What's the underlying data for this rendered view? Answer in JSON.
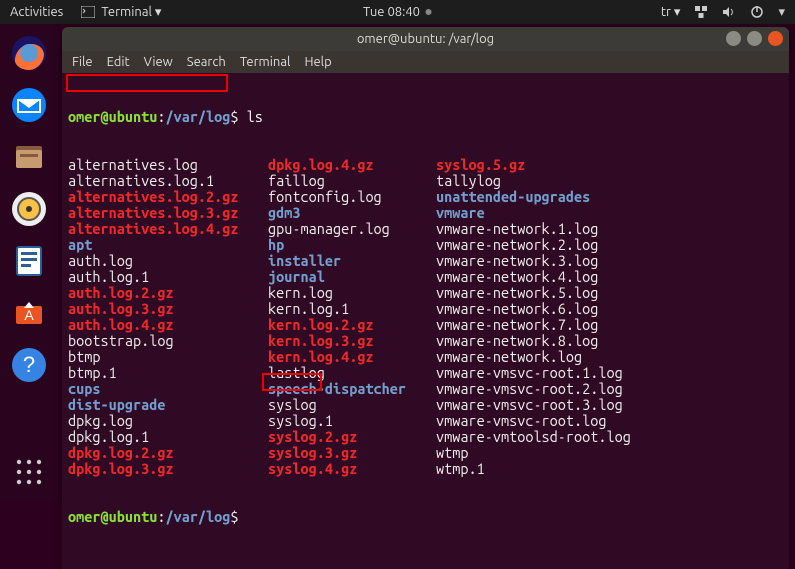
{
  "top_panel": {
    "activities": "Activities",
    "app_indicator": "Terminal ▾",
    "clock": "Tue 08:40",
    "lang": "tr ▾"
  },
  "dock": {
    "items": [
      "firefox",
      "thunderbird",
      "files",
      "rhythmbox",
      "libreoffice",
      "software",
      "help",
      "apps"
    ]
  },
  "window": {
    "title": "omer@ubuntu: /var/log"
  },
  "menubar": {
    "items": [
      "File",
      "Edit",
      "View",
      "Search",
      "Terminal",
      "Help"
    ]
  },
  "prompt": {
    "user_host": "omer@ubuntu",
    "sep": ":",
    "path": "/var/log",
    "dollar": "$",
    "command": "ls"
  },
  "listing": [
    {
      "c1": {
        "t": "alternatives.log",
        "k": "plain"
      },
      "c2": {
        "t": "dpkg.log.4.gz",
        "k": "arch"
      },
      "c3": {
        "t": "syslog.5.gz",
        "k": "arch"
      }
    },
    {
      "c1": {
        "t": "alternatives.log.1",
        "k": "plain"
      },
      "c2": {
        "t": "faillog",
        "k": "plain"
      },
      "c3": {
        "t": "tallylog",
        "k": "plain"
      }
    },
    {
      "c1": {
        "t": "alternatives.log.2.gz",
        "k": "arch"
      },
      "c2": {
        "t": "fontconfig.log",
        "k": "plain"
      },
      "c3": {
        "t": "unattended-upgrades",
        "k": "dir"
      }
    },
    {
      "c1": {
        "t": "alternatives.log.3.gz",
        "k": "arch"
      },
      "c2": {
        "t": "gdm3",
        "k": "dir"
      },
      "c3": {
        "t": "vmware",
        "k": "dir"
      }
    },
    {
      "c1": {
        "t": "alternatives.log.4.gz",
        "k": "arch"
      },
      "c2": {
        "t": "gpu-manager.log",
        "k": "plain"
      },
      "c3": {
        "t": "vmware-network.1.log",
        "k": "plain"
      }
    },
    {
      "c1": {
        "t": "apt",
        "k": "dir"
      },
      "c2": {
        "t": "hp",
        "k": "dir"
      },
      "c3": {
        "t": "vmware-network.2.log",
        "k": "plain"
      }
    },
    {
      "c1": {
        "t": "auth.log",
        "k": "plain"
      },
      "c2": {
        "t": "installer",
        "k": "dir"
      },
      "c3": {
        "t": "vmware-network.3.log",
        "k": "plain"
      }
    },
    {
      "c1": {
        "t": "auth.log.1",
        "k": "plain"
      },
      "c2": {
        "t": "journal",
        "k": "dir"
      },
      "c3": {
        "t": "vmware-network.4.log",
        "k": "plain"
      }
    },
    {
      "c1": {
        "t": "auth.log.2.gz",
        "k": "arch"
      },
      "c2": {
        "t": "kern.log",
        "k": "plain"
      },
      "c3": {
        "t": "vmware-network.5.log",
        "k": "plain"
      }
    },
    {
      "c1": {
        "t": "auth.log.3.gz",
        "k": "arch"
      },
      "c2": {
        "t": "kern.log.1",
        "k": "plain"
      },
      "c3": {
        "t": "vmware-network.6.log",
        "k": "plain"
      }
    },
    {
      "c1": {
        "t": "auth.log.4.gz",
        "k": "arch"
      },
      "c2": {
        "t": "kern.log.2.gz",
        "k": "arch"
      },
      "c3": {
        "t": "vmware-network.7.log",
        "k": "plain"
      }
    },
    {
      "c1": {
        "t": "bootstrap.log",
        "k": "plain"
      },
      "c2": {
        "t": "kern.log.3.gz",
        "k": "arch"
      },
      "c3": {
        "t": "vmware-network.8.log",
        "k": "plain"
      }
    },
    {
      "c1": {
        "t": "btmp",
        "k": "plain"
      },
      "c2": {
        "t": "kern.log.4.gz",
        "k": "arch"
      },
      "c3": {
        "t": "vmware-network.log",
        "k": "plain"
      }
    },
    {
      "c1": {
        "t": "btmp.1",
        "k": "plain"
      },
      "c2": {
        "t": "lastlog",
        "k": "plain"
      },
      "c3": {
        "t": "vmware-vmsvc-root.1.log",
        "k": "plain"
      }
    },
    {
      "c1": {
        "t": "cups",
        "k": "dir"
      },
      "c2": {
        "t": "speech-dispatcher",
        "k": "dir"
      },
      "c3": {
        "t": "vmware-vmsvc-root.2.log",
        "k": "plain"
      }
    },
    {
      "c1": {
        "t": "dist-upgrade",
        "k": "dir"
      },
      "c2": {
        "t": "syslog",
        "k": "plain"
      },
      "c3": {
        "t": "vmware-vmsvc-root.3.log",
        "k": "plain"
      }
    },
    {
      "c1": {
        "t": "dpkg.log",
        "k": "plain"
      },
      "c2": {
        "t": "syslog.1",
        "k": "plain"
      },
      "c3": {
        "t": "vmware-vmsvc-root.log",
        "k": "plain"
      }
    },
    {
      "c1": {
        "t": "dpkg.log.1",
        "k": "plain"
      },
      "c2": {
        "t": "syslog.2.gz",
        "k": "arch"
      },
      "c3": {
        "t": "vmware-vmtoolsd-root.log",
        "k": "plain"
      }
    },
    {
      "c1": {
        "t": "dpkg.log.2.gz",
        "k": "arch"
      },
      "c2": {
        "t": "syslog.3.gz",
        "k": "arch"
      },
      "c3": {
        "t": "wtmp",
        "k": "plain"
      }
    },
    {
      "c1": {
        "t": "dpkg.log.3.gz",
        "k": "arch"
      },
      "c2": {
        "t": "syslog.4.gz",
        "k": "arch"
      },
      "c3": {
        "t": "wtmp.1",
        "k": "plain"
      }
    }
  ]
}
